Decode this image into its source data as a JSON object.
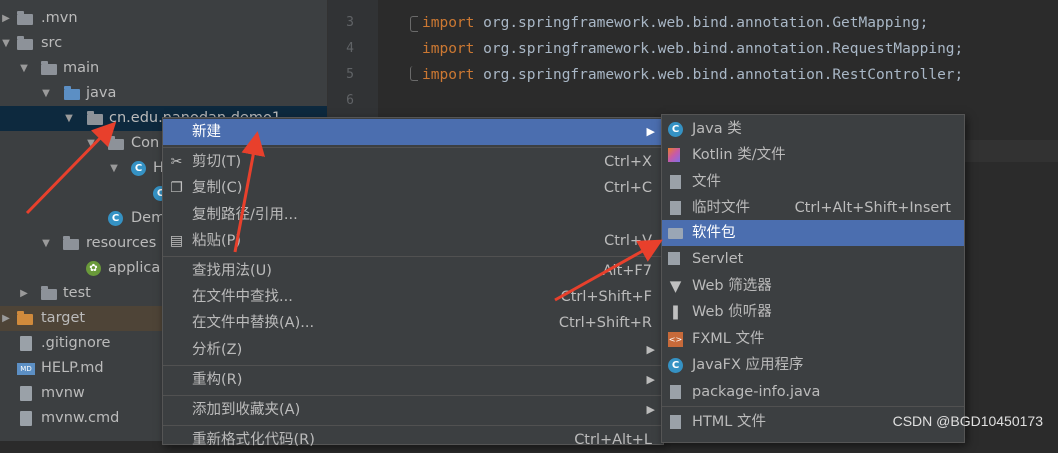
{
  "tree": {
    "items": [
      {
        "label": ".mvn",
        "kind": "folder"
      },
      {
        "label": "src",
        "kind": "folder"
      },
      {
        "label": "main",
        "kind": "folder"
      },
      {
        "label": "java",
        "kind": "folder-blue"
      },
      {
        "label": "cn.edu.nanodan.demo1",
        "kind": "package"
      },
      {
        "label": "Con",
        "kind": "folder"
      },
      {
        "label": "H",
        "kind": "class"
      },
      {
        "label": "",
        "kind": "class"
      },
      {
        "label": "Dem",
        "kind": "class"
      },
      {
        "label": "resources",
        "kind": "folder"
      },
      {
        "label": "applica",
        "kind": "spring"
      },
      {
        "label": "test",
        "kind": "folder"
      },
      {
        "label": "target",
        "kind": "folder-orange"
      },
      {
        "label": ".gitignore",
        "kind": "file"
      },
      {
        "label": "HELP.md",
        "kind": "md"
      },
      {
        "label": "mvnw",
        "kind": "file"
      },
      {
        "label": "mvnw.cmd",
        "kind": "file"
      }
    ]
  },
  "editor": {
    "line_numbers": [
      "3",
      "4",
      "5",
      "6"
    ],
    "lines": [
      {
        "keyword": "import",
        "text": "org.springframework.web.bind.annotation.GetMapping;"
      },
      {
        "keyword": "import",
        "text": "org.springframework.web.bind.annotation.RequestMapping;"
      },
      {
        "keyword": "import",
        "text": "org.springframework.web.bind.annotation.RestController;"
      }
    ]
  },
  "context_menu": {
    "items": [
      {
        "label": "新建",
        "shortcut": "",
        "submenu": true,
        "icon": ""
      },
      {
        "label": "剪切(T)",
        "shortcut": "Ctrl+X",
        "icon": "scissors-icon"
      },
      {
        "label": "复制(C)",
        "shortcut": "Ctrl+C",
        "icon": "copy-icon"
      },
      {
        "label": "复制路径/引用...",
        "shortcut": "",
        "icon": ""
      },
      {
        "label": "粘贴(P)",
        "shortcut": "Ctrl+V",
        "icon": "paste-icon"
      },
      {
        "label": "查找用法(U)",
        "shortcut": "Alt+F7",
        "icon": ""
      },
      {
        "label": "在文件中查找...",
        "shortcut": "Ctrl+Shift+F",
        "icon": ""
      },
      {
        "label": "在文件中替换(A)...",
        "shortcut": "Ctrl+Shift+R",
        "icon": ""
      },
      {
        "label": "分析(Z)",
        "shortcut": "",
        "submenu": true,
        "icon": ""
      },
      {
        "label": "重构(R)",
        "shortcut": "",
        "submenu": true,
        "icon": ""
      },
      {
        "label": "添加到收藏夹(A)",
        "shortcut": "",
        "submenu": true,
        "icon": ""
      },
      {
        "label": "重新格式化代码(R)",
        "shortcut": "Ctrl+Alt+L",
        "icon": ""
      }
    ]
  },
  "submenu": {
    "items": [
      {
        "label": "Java 类",
        "shortcut": "",
        "icon": "java-class-icon"
      },
      {
        "label": "Kotlin 类/文件",
        "shortcut": "",
        "icon": "kotlin-icon"
      },
      {
        "label": "文件",
        "shortcut": "",
        "icon": "file-icon"
      },
      {
        "label": "临时文件",
        "shortcut": "Ctrl+Alt+Shift+Insert",
        "icon": "scratch-file-icon"
      },
      {
        "label": "软件包",
        "shortcut": "",
        "icon": "package-icon"
      },
      {
        "label": "Servlet",
        "shortcut": "",
        "icon": "servlet-icon"
      },
      {
        "label": "Web 筛选器",
        "shortcut": "",
        "icon": "filter-icon"
      },
      {
        "label": "Web 侦听器",
        "shortcut": "",
        "icon": "listener-icon"
      },
      {
        "label": "FXML 文件",
        "shortcut": "",
        "icon": "fxml-icon"
      },
      {
        "label": "JavaFX 应用程序",
        "shortcut": "",
        "icon": "javafx-icon"
      },
      {
        "label": "package-info.java",
        "shortcut": "",
        "icon": "package-info-icon"
      },
      {
        "label": "HTML 文件",
        "shortcut": "",
        "icon": "html-icon"
      }
    ]
  },
  "watermark": "CSDN @BGD10450173",
  "colors": {
    "highlight": "#4b6eaf",
    "arrow": "#e8402c",
    "keyword": "#cc7832"
  }
}
